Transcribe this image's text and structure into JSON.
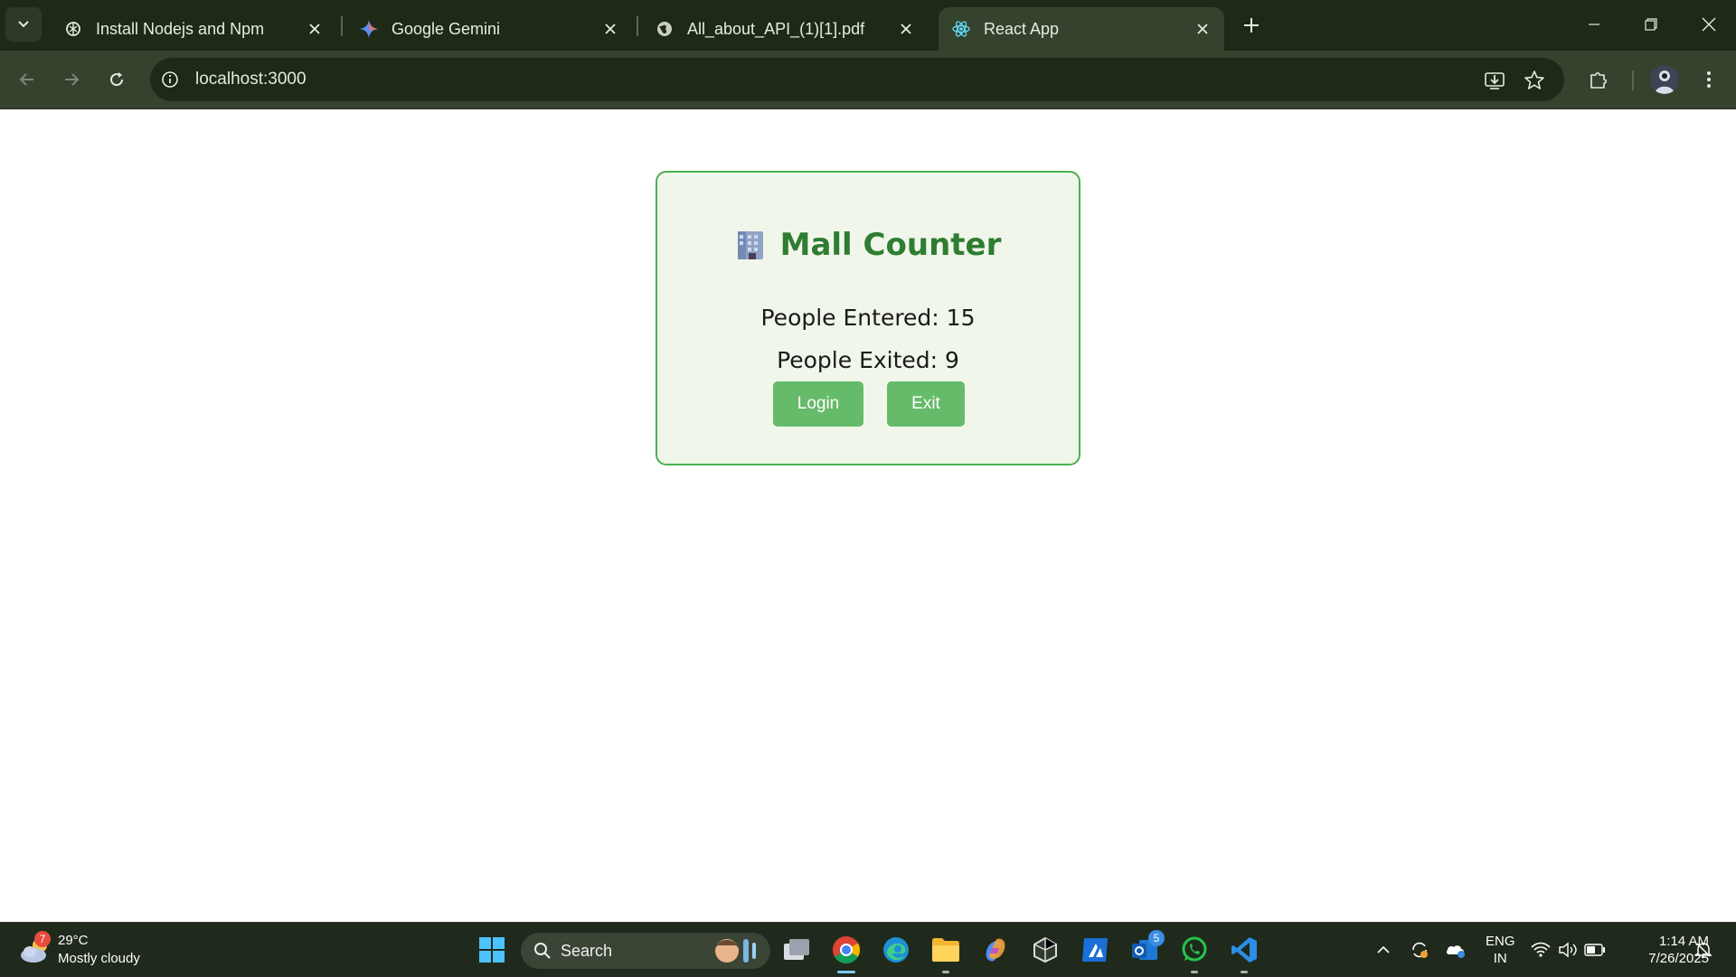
{
  "browser": {
    "tabs": [
      {
        "title": "Install Nodejs and Npm",
        "favicon": "openai-icon",
        "active": false
      },
      {
        "title": "Google Gemini",
        "favicon": "gemini-icon",
        "active": false
      },
      {
        "title": "All_about_API_(1)[1].pdf",
        "favicon": "globe-icon",
        "active": false
      },
      {
        "title": "React App",
        "favicon": "react-icon",
        "active": true
      }
    ],
    "address": {
      "url": "localhost:3000"
    }
  },
  "app": {
    "title": "Mall Counter",
    "title_icon": "building-icon",
    "entered": "People Entered: 15",
    "exited": "People Exited: 9",
    "login_button": "Login",
    "exit_button": "Exit",
    "colors": {
      "accent": "#2e7d32",
      "button": "#66bb6a",
      "card_bg": "#f1f6ea",
      "border": "#4caf50"
    }
  },
  "taskbar": {
    "weather": {
      "temp": "29°C",
      "condition": "Mostly cloudy",
      "badge": "7"
    },
    "search_label": "Search",
    "notification_badge": "5",
    "language": {
      "lang": "ENG",
      "region": "IN"
    },
    "clock": {
      "time": "1:14 AM",
      "date": "7/26/2025"
    }
  }
}
